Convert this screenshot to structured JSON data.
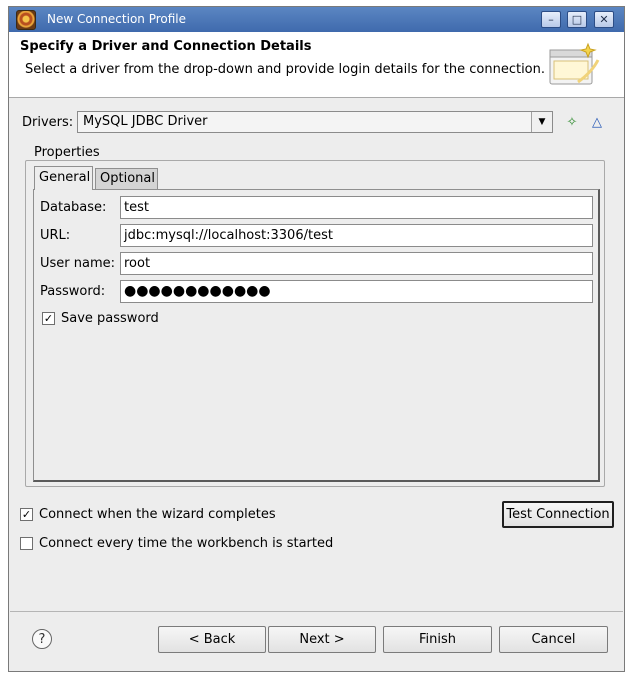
{
  "window": {
    "title": "New Connection Profile",
    "icon": "eclipse-app-icon",
    "controls": [
      "minimize-icon",
      "maximize-icon",
      "close-icon"
    ]
  },
  "banner": {
    "title": "Specify a Driver and Connection Details",
    "description": "Select a driver from the drop-down and provide login details for the connection."
  },
  "drivers": {
    "label": "Drivers:",
    "selected": "MySQL JDBC Driver",
    "add_icon": "new-driver-icon",
    "edit_icon": "edit-driver-icon"
  },
  "properties": {
    "group_label": "Properties",
    "tabs": [
      {
        "label": "General",
        "active": true
      },
      {
        "label": "Optional",
        "active": false
      }
    ],
    "fields": {
      "database": {
        "label": "Database:",
        "value": "test"
      },
      "url": {
        "label": "URL:",
        "value": "jdbc:mysql://localhost:3306/test"
      },
      "username": {
        "label": "User name:",
        "value": "root"
      },
      "password": {
        "label": "Password:",
        "value": "●●●●●●●●●●●●"
      }
    },
    "save_password": {
      "label": "Save password",
      "checked": true
    }
  },
  "options": {
    "connect_on_complete": {
      "label": "Connect when the wizard completes",
      "checked": true
    },
    "connect_every_time": {
      "label": "Connect every time the workbench is started",
      "checked": false
    },
    "test_connection": "Test Connection"
  },
  "footer": {
    "help_icon": "help-icon",
    "back": "< Back",
    "next": "Next >",
    "finish": "Finish",
    "cancel": "Cancel"
  }
}
